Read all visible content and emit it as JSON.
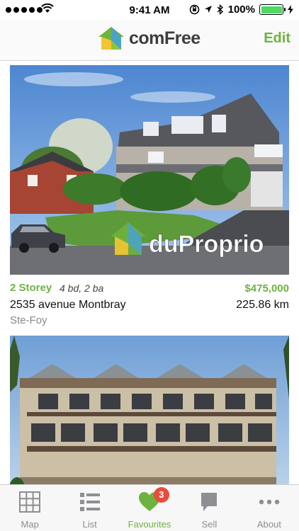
{
  "status_bar": {
    "time": "9:41 AM",
    "battery": "100%"
  },
  "nav": {
    "brand": "comFree",
    "edit_label": "Edit"
  },
  "listings": [
    {
      "type": "2 Storey",
      "beds_baths": "4 bd, 2 ba",
      "price": "$475,000",
      "address": "2535 avenue Montbray",
      "distance": "225.86 km",
      "city": "Ste-Foy",
      "watermark": "duProprio"
    },
    {
      "type": "",
      "beds_baths": "",
      "price": "",
      "address": "",
      "distance": "",
      "city": ""
    }
  ],
  "tabs": [
    {
      "label": "Map",
      "icon": "grid-map-icon"
    },
    {
      "label": "List",
      "icon": "list-icon"
    },
    {
      "label": "Favourites",
      "icon": "heart-icon",
      "badge": "3",
      "active": true
    },
    {
      "label": "Sell",
      "icon": "speech-bubble-icon"
    },
    {
      "label": "About",
      "icon": "ellipsis-icon"
    }
  ],
  "colors": {
    "accent": "#6db33f",
    "badge": "#e74c3c",
    "inactive_tab": "#8e8e93"
  }
}
